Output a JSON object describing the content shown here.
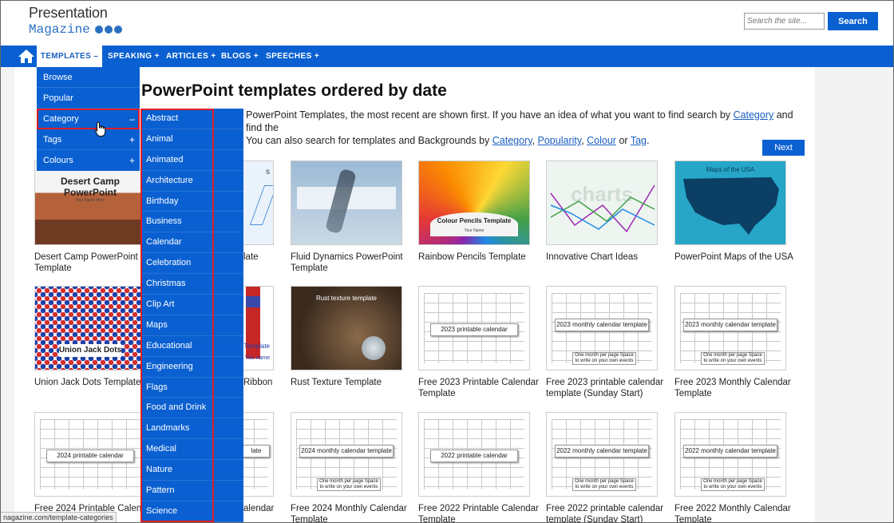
{
  "header": {
    "logo_line1": "Presentation",
    "logo_line2": "Magazine",
    "search_placeholder": "Search the site...",
    "search_button": "Search"
  },
  "nav": {
    "items": [
      {
        "label": "TEMPLATES –"
      },
      {
        "label": "SPEAKING +"
      },
      {
        "label": "ARTICLES +"
      },
      {
        "label": "BLOGS +"
      },
      {
        "label": "SPEECHES +"
      }
    ]
  },
  "dropdown": {
    "items": [
      {
        "label": "Browse",
        "sign": ""
      },
      {
        "label": "Popular",
        "sign": ""
      },
      {
        "label": "Category",
        "sign": "–"
      },
      {
        "label": "Tags",
        "sign": "+"
      },
      {
        "label": "Colours",
        "sign": "+"
      }
    ]
  },
  "categories": [
    "Abstract",
    "Animal",
    "Animated",
    "Architecture",
    "Birthday",
    "Business",
    "Calendar",
    "Celebration",
    "Christmas",
    "Clip Art",
    "Maps",
    "Educational",
    "Engineering",
    "Flags",
    "Food and Drink",
    "Landmarks",
    "Medical",
    "Nature",
    "Pattern",
    "Science"
  ],
  "main": {
    "title": "PowerPoint templates ordered by date",
    "intro_1": "PowerPoint Templates, the most recent are shown first. If you have an idea of what you want to find search by ",
    "intro_link_category": "Category",
    "intro_2": " and find the",
    "intro_3": "You can also search for templates and Backgrounds by ",
    "link_category": "Category",
    "link_popularity": "Popularity",
    "link_colour": "Colour",
    "intro_or": " or ",
    "link_tag": "Tag",
    "next_button": "Next"
  },
  "cards": {
    "r1": [
      {
        "title": "Desert Camp PowerPoint Template",
        "thumb_heading": "Desert Camp PowerPoint",
        "thumb_sub": "Your Name Here"
      },
      {
        "title": "late",
        "thumb_heading": "s",
        "thumb_sub": ""
      },
      {
        "title": "Fluid Dynamics PowerPoint Template",
        "thumb_heading": "",
        "thumb_sub": ""
      },
      {
        "title": "Rainbow Pencils Template",
        "thumb_heading": "Colour Pencils Template",
        "thumb_sub": "Your Name"
      },
      {
        "title": "Innovative Chart Ideas",
        "thumb_heading": "charts",
        "thumb_sub": ""
      },
      {
        "title": "PowerPoint Maps of the USA",
        "thumb_heading": "Maps of the USA",
        "thumb_sub": ""
      }
    ],
    "r2": [
      {
        "title": "Union Jack Dots Template",
        "thumb_heading": "Union Jack Dots",
        "thumb_sub": ""
      },
      {
        "title": "Ribbon",
        "thumb_heading": "Template",
        "thumb_sub": "You name"
      },
      {
        "title": "Rust Texture Template",
        "thumb_heading": "Rust texture template",
        "thumb_sub": ""
      },
      {
        "title": "Free 2023 Printable Calendar Template",
        "thumb_heading": "2023 printable calendar",
        "thumb_sub": ""
      },
      {
        "title": "Free 2023 printable calendar template (Sunday Start)",
        "thumb_heading": "2023 monthly calendar template",
        "thumb_sub": "One month per page Space to write on your own events"
      },
      {
        "title": "Free 2023 Monthly Calendar Template",
        "thumb_heading": "2023 monthly calendar template",
        "thumb_sub": "One month per page Space to write on your own events"
      }
    ],
    "r3": [
      {
        "title": "Free 2024 Printable Calend",
        "thumb_heading": "2024 printable calendar",
        "thumb_sub": ""
      },
      {
        "title": "alendar",
        "thumb_heading": "late",
        "thumb_sub": ""
      },
      {
        "title": "Free 2024 Monthly Calendar Template",
        "thumb_heading": "2024 monthly calendar template",
        "thumb_sub": "One month per page Space to write on your own events"
      },
      {
        "title": "Free 2022 Printable Calendar Template",
        "thumb_heading": "2022 printable calendar",
        "thumb_sub": ""
      },
      {
        "title": "Free 2022 printable calendar template (Sunday Start)",
        "thumb_heading": "2022 monthly calendar template",
        "thumb_sub": "One month per page Space to write on your own events"
      },
      {
        "title": "Free 2022 Monthly Calendar Template",
        "thumb_heading": "2022 monthly calendar template",
        "thumb_sub": "One month per page Space to write on your own events"
      }
    ]
  },
  "status": {
    "url": "nagazine.com/template-categories"
  },
  "colors": {
    "nav_blue": "#0a60d1",
    "highlight_red": "#e21c23"
  }
}
